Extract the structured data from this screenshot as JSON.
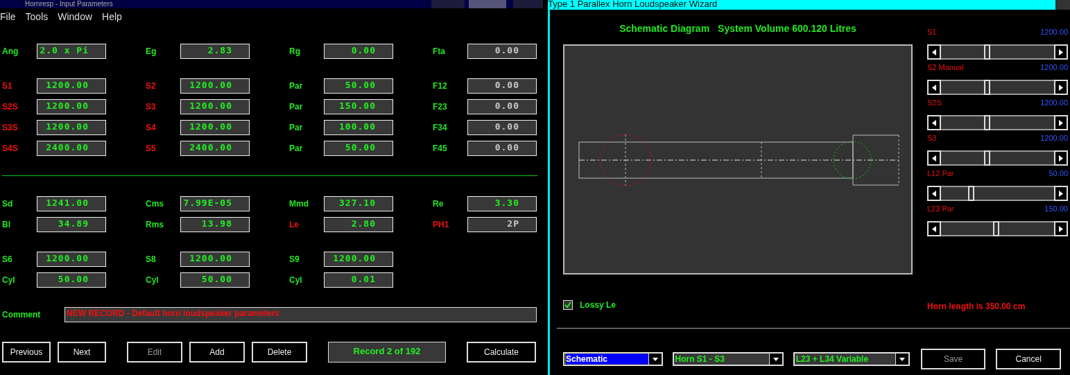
{
  "input_window": {
    "title": "Hornresp - Input Parameters",
    "menu": [
      {
        "label": "File"
      },
      {
        "label": "Tools"
      },
      {
        "label": "Window"
      },
      {
        "label": "Help"
      }
    ],
    "sections": [
      {
        "kind": "fields",
        "rows": [
          [
            {
              "label": "Ang",
              "color": "#22e622",
              "field": {
                "value": "2.0 x Pi",
                "greyed": false
              }
            },
            {
              "label": "Eg",
              "color": "#22e622",
              "field": {
                "value": "2.83",
                "greyed": false
              }
            },
            {
              "label": "Rg",
              "color": "#22e622",
              "field": {
                "value": "0.00",
                "greyed": false
              }
            },
            {
              "label": "Fta",
              "color": "#22e622",
              "field": {
                "value": "0.00",
                "greyed": true
              }
            }
          ]
        ]
      },
      {
        "kind": "fields",
        "rows": [
          [
            {
              "label": "S1",
              "color": "#ee1111",
              "field": {
                "value": "1200.00",
                "greyed": false
              }
            },
            {
              "label": "S2",
              "color": "#ee1111",
              "field": {
                "value": "1200.00",
                "greyed": false
              }
            },
            {
              "label": "Par",
              "color": "#22e622",
              "field": {
                "value": "50.00",
                "greyed": false
              }
            },
            {
              "label": "F12",
              "color": "#22e622",
              "field": {
                "value": "0.00",
                "greyed": true
              }
            }
          ],
          [
            {
              "label": "S2S",
              "color": "#ee1111",
              "field": {
                "value": "1200.00",
                "greyed": false
              }
            },
            {
              "label": "S3",
              "color": "#ee1111",
              "field": {
                "value": "1200.00",
                "greyed": false
              }
            },
            {
              "label": "Par",
              "color": "#22e622",
              "field": {
                "value": "150.00",
                "greyed": false
              }
            },
            {
              "label": "F23",
              "color": "#22e622",
              "field": {
                "value": "0.00",
                "greyed": true
              }
            }
          ],
          [
            {
              "label": "S3S",
              "color": "#ee1111",
              "field": {
                "value": "1200.00",
                "greyed": false
              }
            },
            {
              "label": "S4",
              "color": "#ee1111",
              "field": {
                "value": "1200.00",
                "greyed": false
              }
            },
            {
              "label": "Par",
              "color": "#22e622",
              "field": {
                "value": "100.00",
                "greyed": false
              }
            },
            {
              "label": "F34",
              "color": "#22e622",
              "field": {
                "value": "0.00",
                "greyed": true
              }
            }
          ],
          [
            {
              "label": "S4S",
              "color": "#ee1111",
              "field": {
                "value": "2400.00",
                "greyed": false
              }
            },
            {
              "label": "S5",
              "color": "#ee1111",
              "field": {
                "value": "2400.00",
                "greyed": false
              }
            },
            {
              "label": "Par",
              "color": "#22e622",
              "field": {
                "value": "50.00",
                "greyed": false
              }
            },
            {
              "label": "F45",
              "color": "#22e622",
              "field": {
                "value": "0.00",
                "greyed": true
              }
            }
          ]
        ]
      },
      {
        "kind": "rule"
      },
      {
        "kind": "fields",
        "rows": [
          [
            {
              "label": "Sd",
              "color": "#22e622",
              "field": {
                "value": "1241.00",
                "greyed": false
              }
            },
            {
              "label": "Cms",
              "color": "#22e622",
              "field": {
                "value": "7.99E-05",
                "greyed": false
              }
            },
            {
              "label": "Mmd",
              "color": "#22e622",
              "field": {
                "value": "327.10",
                "greyed": false
              }
            },
            {
              "label": "Re",
              "color": "#22e622",
              "field": {
                "value": "3.30",
                "greyed": false
              }
            }
          ],
          [
            {
              "label": "Bl",
              "color": "#22e622",
              "field": {
                "value": "34.89",
                "greyed": false
              }
            },
            {
              "label": "Rms",
              "color": "#22e622",
              "field": {
                "value": "13.98",
                "greyed": false
              }
            },
            {
              "label": "Le",
              "color": "#ee1111",
              "field": {
                "value": "2.80",
                "greyed": false
              }
            },
            {
              "label": "PH1",
              "color": "#ee1111",
              "field": {
                "value": "2P",
                "greyed": true
              }
            }
          ]
        ]
      },
      {
        "kind": "fields",
        "rows": [
          [
            {
              "label": "S6",
              "color": "#22e622",
              "field": {
                "value": "1200.00",
                "greyed": false
              }
            },
            {
              "label": "S8",
              "color": "#22e622",
              "field": {
                "value": "1200.00",
                "greyed": false
              }
            },
            {
              "label": "S9",
              "color": "#22e622",
              "field": {
                "value": "1200.00",
                "greyed": false
              }
            }
          ],
          [
            {
              "label": "Cyl",
              "color": "#22e622",
              "field": {
                "value": "50.00",
                "greyed": false
              }
            },
            {
              "label": "Cyl",
              "color": "#22e622",
              "field": {
                "value": "50.00",
                "greyed": false
              }
            },
            {
              "label": "Cyl",
              "color": "#22e622",
              "field": {
                "value": "0.01",
                "greyed": false
              }
            }
          ]
        ]
      }
    ],
    "comment": {
      "label": "Comment",
      "value": "NEW RECORD - Default horn loudspeaker parameters"
    },
    "buttons": [
      {
        "kind": "button",
        "label": "Previous",
        "disabled": false
      },
      {
        "kind": "button",
        "label": "Next",
        "disabled": false
      },
      {
        "kind": "button",
        "label": "Edit",
        "disabled": true
      },
      {
        "kind": "button",
        "label": "Add",
        "disabled": false
      },
      {
        "kind": "button",
        "label": "Delete",
        "disabled": false
      },
      {
        "kind": "status",
        "label": "Record 2 of 192"
      },
      {
        "kind": "button",
        "label": "Calculate",
        "disabled": false
      }
    ]
  },
  "wizard_window": {
    "title": "Type 1 Parallex Horn Loudspeaker Wizard",
    "heading": [
      "Schematic Diagram",
      "System Volume 600.120 Litres"
    ],
    "sliders": [
      {
        "label": "S1",
        "value": "1200.00",
        "level": 0.4
      },
      {
        "label": "S2 Manual",
        "value": "1200.00",
        "level": 0.4
      },
      {
        "label": "S2S",
        "value": "1200.00",
        "level": 0.4
      },
      {
        "label": "S3",
        "value": "1200.00",
        "level": 0.4
      },
      {
        "label": "L12 Par",
        "value": "50.00",
        "level": 0.25
      },
      {
        "label": "L23 Par",
        "value": "150.00",
        "level": 0.49
      }
    ],
    "lossy_le": {
      "label": "Lossy Le",
      "checked": true
    },
    "horn_length": "Horn length is 350.00 cm",
    "dropdowns": [
      {
        "value": "Schematic",
        "focused": true
      },
      {
        "value": "Horn S1 - S3",
        "focused": false
      },
      {
        "value": "L23 + L34 Variable",
        "focused": false
      }
    ],
    "buttons": [
      {
        "label": "Save",
        "disabled": true
      },
      {
        "label": "Cancel",
        "disabled": false
      }
    ]
  }
}
